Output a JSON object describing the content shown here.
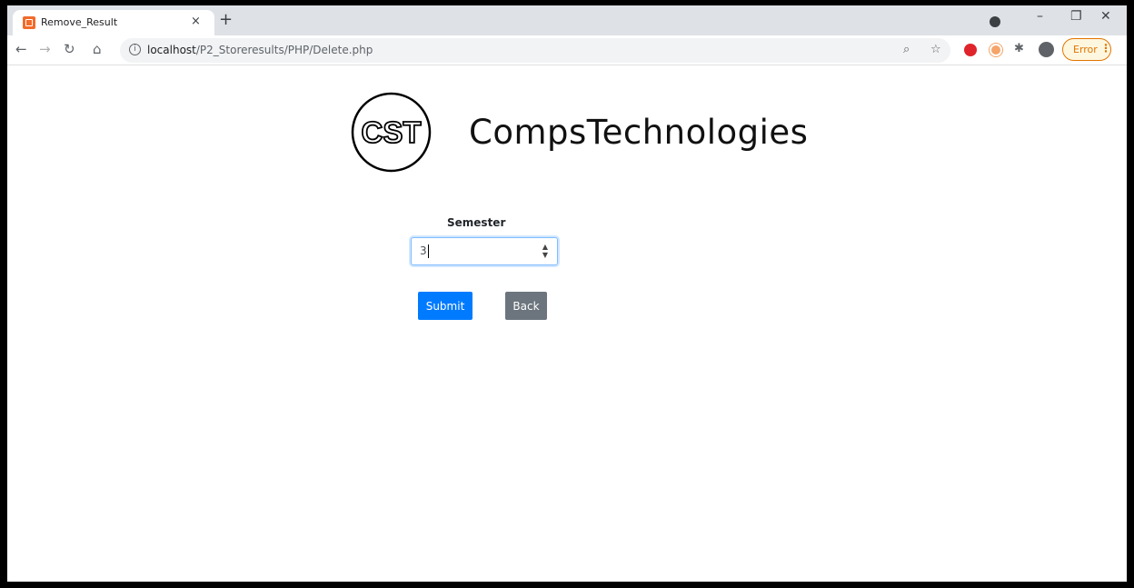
{
  "browser": {
    "tab_title": "Remove_Result",
    "tab_close": "×",
    "new_tab": "+",
    "url_host": "localhost",
    "url_path": "/P2_Storeresults/PHP/Delete.php",
    "error_label": "Error",
    "window_controls": {
      "minimize": "–",
      "restore": "❐",
      "close": "✕"
    },
    "icons": [
      "back-arrow-icon",
      "forward-arrow-icon",
      "reload-icon",
      "home-icon",
      "info-icon",
      "zoom-icon",
      "star-icon",
      "extension-icon",
      "profile-icon"
    ]
  },
  "page": {
    "brand": "CompsTechnologies",
    "logo_text": "CST",
    "form": {
      "label": "Semester",
      "value": "3",
      "submit_label": "Submit",
      "back_label": "Back"
    }
  },
  "colors": {
    "primary": "#007bff",
    "secondary": "#6c757d",
    "error": "#e37400"
  }
}
